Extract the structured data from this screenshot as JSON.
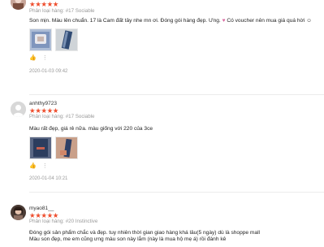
{
  "reviews": [
    {
      "username": "",
      "variation": "Phân loại hàng: #17 Sociable",
      "comment_text": "Son mịn. Màu lên chuẩn. 17 là Cam đất tây nhe mn ơi. Đóng gói hàng đẹp. Ưng.",
      "comment_tail": "Có voucher nên mua giá quá hời",
      "timestamp": "2020-01-03 09:42"
    },
    {
      "username": "anhthy9723",
      "variation": "Phân loại hàng: #17 Sociable",
      "comment_text": "Màu rất đẹp, giá rẻ nữa. màu giống với 220 của 3ce",
      "timestamp": "2020-01-04 10:21"
    },
    {
      "username": "myao81__",
      "variation": "Phân loại hàng: #20 Instinctive",
      "comment_line1": "Đóng gói sản phẩm chắc và đẹp. tuy nhiên thời gian giao hàng khá lâu(5 ngày) dù là shoppe mall",
      "comment_line2": "Màu son đẹp, me em cũng ưng màu son này lắm (này là mua hộ mẹ á) rồi đánh kê"
    }
  ],
  "icons": {
    "star": "star-icon",
    "heart": "heart-icon",
    "like": "thumbs-up-icon",
    "more": "more-icon"
  },
  "colors": {
    "star": "#ee4d2d",
    "heart": "#d96aa0"
  }
}
